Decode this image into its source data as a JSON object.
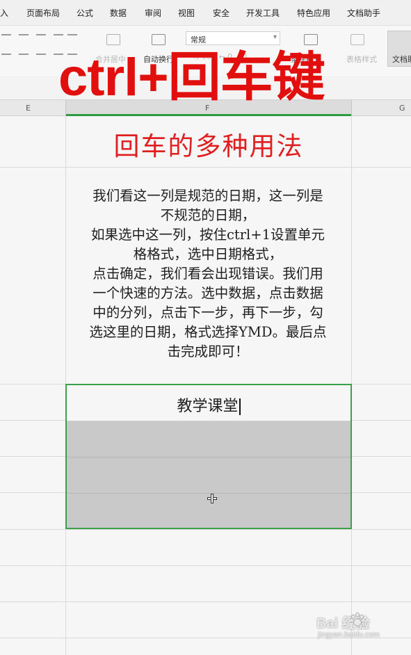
{
  "menu": {
    "items": [
      "入",
      "页面布局",
      "公式",
      "数据",
      "审阅",
      "视图",
      "安全",
      "开发工具",
      "特色应用",
      "文档助手"
    ]
  },
  "ribbon": {
    "merge_center": "合并居中",
    "wrap_text": "自动换行",
    "number_format": "常规",
    "conditional_format": "条件格式",
    "table_style": "表格样式",
    "doc_btn": "文档助"
  },
  "overlay": {
    "text": "ctrl+回车键",
    "color": "#e20f0f"
  },
  "column_headers": {
    "e": "E",
    "f": "F",
    "g": "G"
  },
  "sheet": {
    "title": "回车的多种用法",
    "paragraph_lines": [
      "我们看这一列是规范的日期，这一列是",
      "不规范的日期，",
      "如果选中这一列，按住ctrl+1设置单元",
      "格格式，选中日期格式，",
      "点击确定，我们看会出现错误。我们用",
      "一个快速的方法。选中数据，点击数据",
      "中的分列，点击下一步，再下一步，勾",
      "选这里的日期，格式选择YMD。最后点",
      "击完成即可！"
    ],
    "active_cell_text": "教学课堂"
  },
  "colors": {
    "title_red": "#e02020",
    "selection_green": "#3aa04a"
  },
  "watermark": {
    "brand": "Bai  经验",
    "url": "jingyan.baidu.com"
  }
}
